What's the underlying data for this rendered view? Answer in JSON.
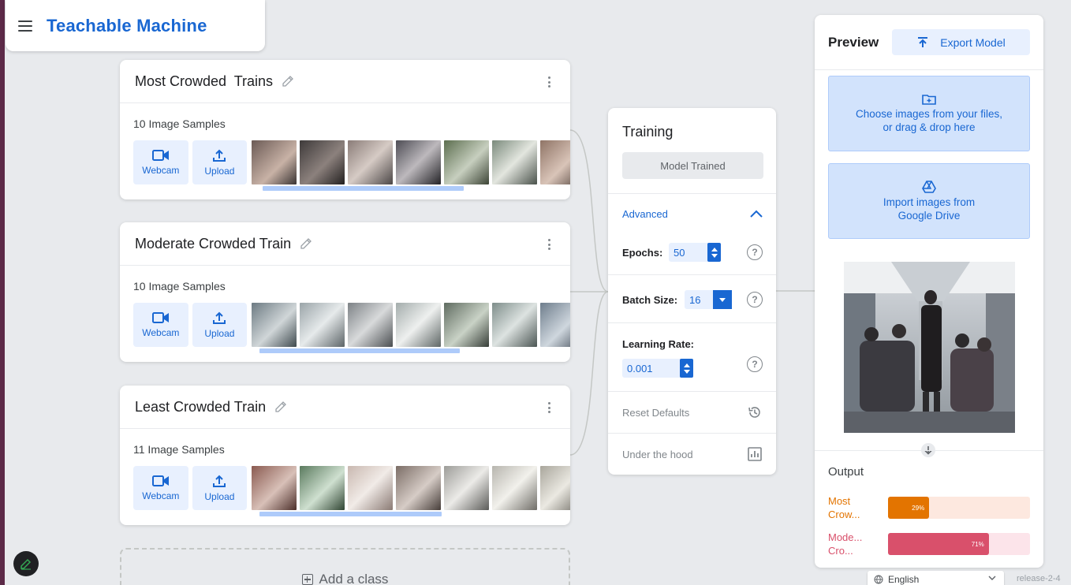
{
  "app": {
    "title": "Teachable Machine"
  },
  "classes": [
    {
      "name": "Most Crowded  Trains",
      "samples": "10 Image Samples",
      "webcam": "Webcam",
      "upload": "Upload",
      "thumb_colors": [
        "#6b5a55",
        "#3e3a3a",
        "#8a7c78",
        "#4d4c54",
        "#5c6e4f",
        "#7a8a7c",
        "#8f7466"
      ]
    },
    {
      "name": "Moderate Crowded Train",
      "samples": "10 Image Samples",
      "webcam": "Webcam",
      "upload": "Upload",
      "thumb_colors": [
        "#6c7a82",
        "#9aa4a8",
        "#7d8286",
        "#a3acab",
        "#5f6b60",
        "#7e8d8a",
        "#6e7d8c"
      ]
    },
    {
      "name": "Least Crowded Train",
      "samples": "11 Image Samples",
      "webcam": "Webcam",
      "upload": "Upload",
      "thumb_colors": [
        "#8a5a50",
        "#5a7a5e",
        "#c9b8b0",
        "#7b6d66",
        "#9c9c98",
        "#b7b5ae",
        "#a9a69c"
      ]
    }
  ],
  "add_class": "Add a class",
  "training": {
    "title": "Training",
    "model_button": "Model Trained",
    "advanced": "Advanced",
    "epochs_label": "Epochs:",
    "epochs_value": "50",
    "batch_label": "Batch Size:",
    "batch_value": "16",
    "lr_label": "Learning Rate:",
    "lr_value": "0.001",
    "reset": "Reset Defaults",
    "under_hood": "Under the hood",
    "help_glyph": "?"
  },
  "preview": {
    "title": "Preview",
    "export": "Export Model",
    "choose_line1": "Choose images from your files,",
    "choose_line2": "or drag & drop here",
    "drive_line1": "Import images from",
    "drive_line2": "Google Drive",
    "output_title": "Output",
    "outputs": [
      {
        "label_line1": "Most",
        "label_line2": "Crow...",
        "percent_text": "29%",
        "fraction": 0.29,
        "color": "#e37400",
        "track": "#fde8df"
      },
      {
        "label_line1": "Mode...",
        "label_line2": "Cro...",
        "percent_text": "71%",
        "fraction": 0.71,
        "color": "#d9506b",
        "track": "#fce4ea"
      }
    ]
  },
  "footer": {
    "language": "English",
    "release": "release-2-4"
  },
  "colors": {
    "accent": "#1967d2",
    "accent_light": "#e8f0fe",
    "background": "#e8eaed"
  }
}
